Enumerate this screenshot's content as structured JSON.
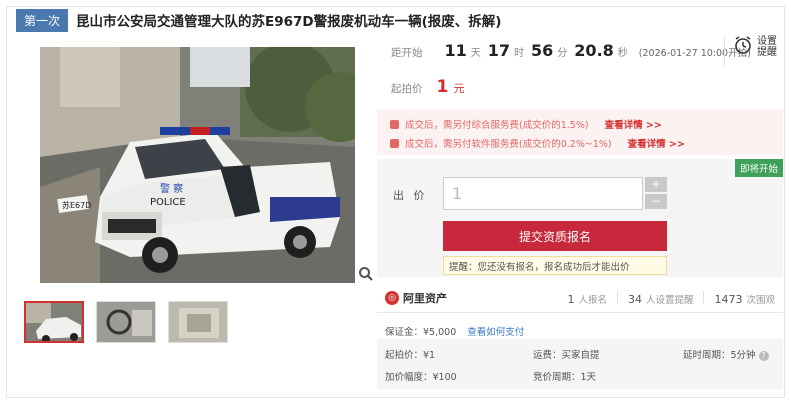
{
  "title": {
    "round_tag": "第一次",
    "text": "昆山市公安局交通管理大队的苏E967D警报废机动车一辆(报废、拆解)"
  },
  "countdown": {
    "label": "距开始",
    "days": "11",
    "days_unit": "天",
    "hours": "17",
    "hours_unit": "时",
    "minutes": "56",
    "minutes_unit": "分",
    "seconds": "20.8",
    "seconds_unit": "秒",
    "start_time": "(2026-01-27 10:00开拍)"
  },
  "reminder": {
    "label": "设置提醒",
    "icon": "alarm-clock-icon"
  },
  "starting_price": {
    "label": "起拍价",
    "value": "1",
    "unit": "元"
  },
  "fees": [
    {
      "text": "成交后，需另付综合服务费(成交价的1.5%)",
      "link": "查看详情 >>"
    },
    {
      "text": "成交后，需另付软件服务费(成交价的0.2%~1%)",
      "link": "查看详情 >>"
    }
  ],
  "bid": {
    "status_tag": "即将开始",
    "label": "出 价",
    "input_value": "1",
    "plus": "+",
    "minus": "−",
    "submit_label": "提交资质报名",
    "tip": "提醒：您还没有报名，报名成功后才能出价"
  },
  "seller": {
    "brand": "阿里资产",
    "registered_count": "1",
    "registered_label": "人报名",
    "reminders_count": "34",
    "reminders_label": "人设置提醒",
    "views_count": "1473",
    "views_label": "次围观"
  },
  "deposit": {
    "label": "保证金：¥5,000",
    "link": "查看如何支付"
  },
  "details": {
    "start_price": "起拍价：¥1",
    "increment": "加价幅度：¥100",
    "shipping": "运费：买家自提",
    "bidding_cycle": "竞价周期：1天",
    "delay_cycle": "延时周期：5分钟"
  },
  "colors": {
    "accent": "#c8283b",
    "tag_blue": "#4a79b0",
    "status_green": "#3ea05a"
  }
}
